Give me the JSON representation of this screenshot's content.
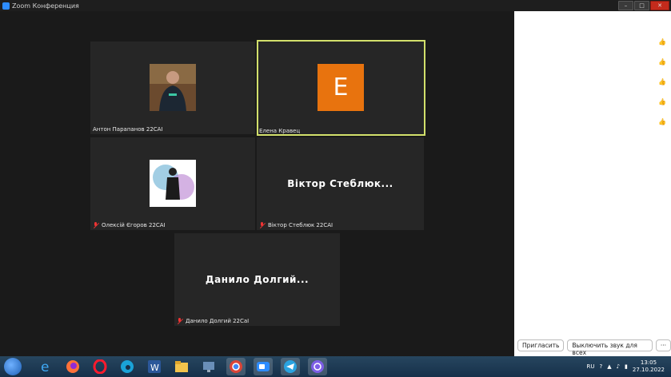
{
  "window": {
    "title": "Zoom Конференция",
    "minimize": "–",
    "maximize": "□",
    "close": "✕"
  },
  "participants": [
    {
      "name": "Антон Парапанов 22CAI",
      "muted": false,
      "avatar": "photo"
    },
    {
      "name": "Елена Кравец",
      "muted": false,
      "avatar": "letter",
      "letter": "E",
      "active": true
    },
    {
      "name": "Олексій Єгоров 22CAI",
      "muted": true,
      "avatar": "photo"
    },
    {
      "name": "Віктор Стеблюк 22CAI",
      "muted": true,
      "avatar": "none",
      "display": "Віктор  Стеблюк..."
    },
    {
      "name": "Данило Долгий 22CaI",
      "muted": true,
      "avatar": "none",
      "display": "Данило  Долгий..."
    }
  ],
  "side_panel": {
    "reactions": [
      "👍",
      "👍",
      "👍",
      "👍",
      "👍"
    ],
    "invite_label": "Пригласить",
    "mute_all_label": "Выключить звук для всех",
    "more_label": "···"
  },
  "taskbar": {
    "apps": [
      "windows-start",
      "internet-explorer",
      "firefox",
      "opera",
      "edge",
      "word",
      "file-explorer",
      "media-player",
      "chrome",
      "zoom",
      "telegram",
      "viber"
    ],
    "lang": "RU",
    "time": "13:05",
    "date": "27.10.2022"
  },
  "colors": {
    "active_speaker_border": "#d2e06b",
    "letter_avatar_bg": "#e8730e",
    "muted_icon": "#e33"
  }
}
